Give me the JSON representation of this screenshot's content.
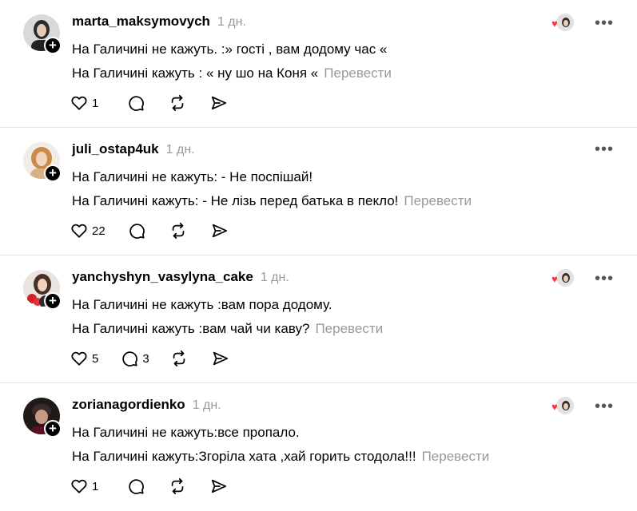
{
  "ui": {
    "translate_label": "Перевести",
    "more_label": "•••",
    "follow_symbol": "+",
    "heart_symbol": "♥"
  },
  "posts": [
    {
      "username": "marta_maksymovych",
      "time": "1 дн.",
      "line1": "На Галичині не кажуть. :» гості , вам додому час «",
      "line2": "На Галичині кажуть : « ну шо на Коня «",
      "likes": "1",
      "replies": "",
      "liked_by_author": true
    },
    {
      "username": "juli_ostap4uk",
      "time": "1 дн.",
      "line1": "На Галичині не кажуть: - Не поспішай!",
      "line2": "На Галичині кажуть: - Не лізь перед батька в пекло!",
      "likes": "22",
      "replies": "",
      "liked_by_author": false
    },
    {
      "username": "yanchyshyn_vasylyna_cake",
      "time": "1 дн.",
      "line1": "На Галичині не кажуть :вам пора додому.",
      "line2": "На Галичині кажуть :вам чай чи каву?",
      "likes": "5",
      "replies": "3",
      "liked_by_author": true
    },
    {
      "username": "zorianagordienko",
      "time": "1 дн.",
      "line1": "На Галичині не кажуть:все пропало.",
      "line2": "На Галичині кажуть:Згоріла хата ,хай горить стодола!!!",
      "likes": "1",
      "replies": "",
      "liked_by_author": true
    }
  ],
  "colors": {
    "muted": "#999999",
    "heart": "#ff3040",
    "divider": "#e3e3e3"
  }
}
